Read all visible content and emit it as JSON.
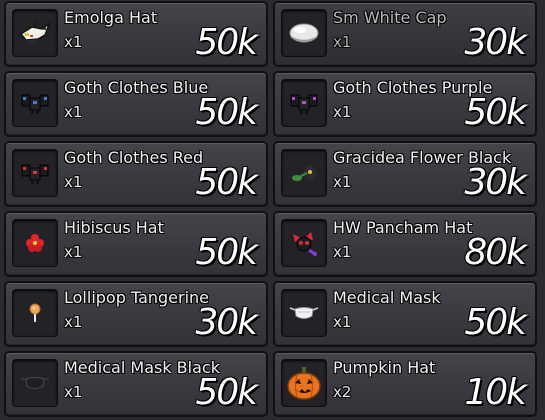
{
  "items": [
    {
      "name": "Emolga Hat",
      "qty": "x1",
      "price": "50k",
      "icon": "emolga-hat-icon",
      "dim": false
    },
    {
      "name": "Sm White Cap",
      "qty": "x1",
      "price": "30k",
      "icon": "white-cap-icon",
      "dim": true
    },
    {
      "name": "Goth Clothes Blue",
      "qty": "x1",
      "price": "50k",
      "icon": "goth-clothes-blue-icon",
      "dim": false
    },
    {
      "name": "Goth Clothes Purple",
      "qty": "x1",
      "price": "50k",
      "icon": "goth-clothes-purple-icon",
      "dim": false
    },
    {
      "name": "Goth Clothes Red",
      "qty": "x1",
      "price": "50k",
      "icon": "goth-clothes-red-icon",
      "dim": false
    },
    {
      "name": "Gracidea Flower Black",
      "qty": "x1",
      "price": "30k",
      "icon": "gracidea-flower-icon",
      "dim": false
    },
    {
      "name": "Hibiscus Hat",
      "qty": "x1",
      "price": "50k",
      "icon": "hibiscus-hat-icon",
      "dim": false
    },
    {
      "name": "HW Pancham Hat",
      "qty": "x1",
      "price": "80k",
      "icon": "pancham-hat-icon",
      "dim": false
    },
    {
      "name": "Lollipop Tangerine",
      "qty": "x1",
      "price": "30k",
      "icon": "lollipop-icon",
      "dim": false
    },
    {
      "name": "Medical Mask",
      "qty": "x1",
      "price": "50k",
      "icon": "medical-mask-icon",
      "dim": false
    },
    {
      "name": "Medical Mask Black",
      "qty": "x1",
      "price": "50k",
      "icon": "medical-mask-black-icon",
      "dim": false
    },
    {
      "name": "Pumpkin Hat",
      "qty": "x2",
      "price": "10k",
      "icon": "pumpkin-hat-icon",
      "dim": false
    }
  ]
}
